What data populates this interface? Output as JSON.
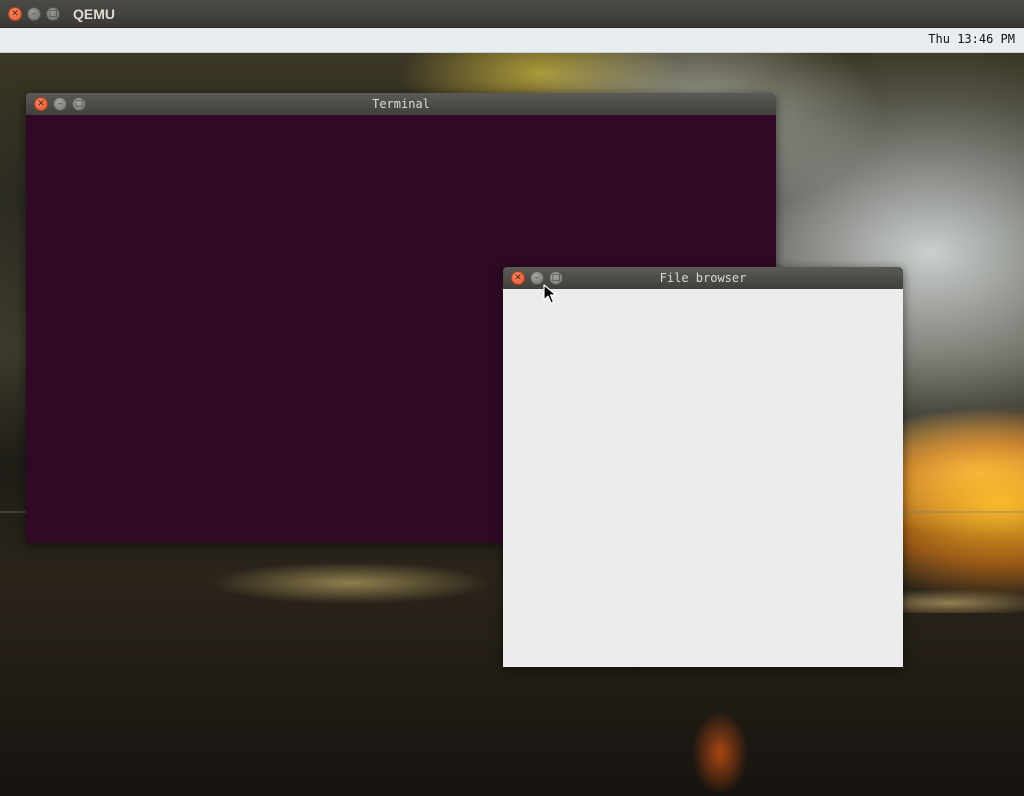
{
  "host_window": {
    "title": "QEMU",
    "buttons": {
      "close_glyph": "✕",
      "minimize_glyph": "–",
      "maximize_glyph": "□"
    }
  },
  "guest_panel": {
    "clock": "Thu 13:46 PM"
  },
  "windows": [
    {
      "id": "terminal",
      "title": "Terminal",
      "background_color": "#300a24",
      "focused": false
    },
    {
      "id": "file-browser",
      "title": "File browser",
      "background_color": "#ececec",
      "focused": true
    }
  ],
  "window_buttons": {
    "close_glyph": "✕",
    "minimize_glyph": "–",
    "maximize_glyph": "□"
  },
  "colors": {
    "close_button": "#df542a",
    "titlebar": "#403f3b",
    "panel": "#e8eef0"
  },
  "icons": {
    "pointer": "arrow-cursor-icon"
  }
}
